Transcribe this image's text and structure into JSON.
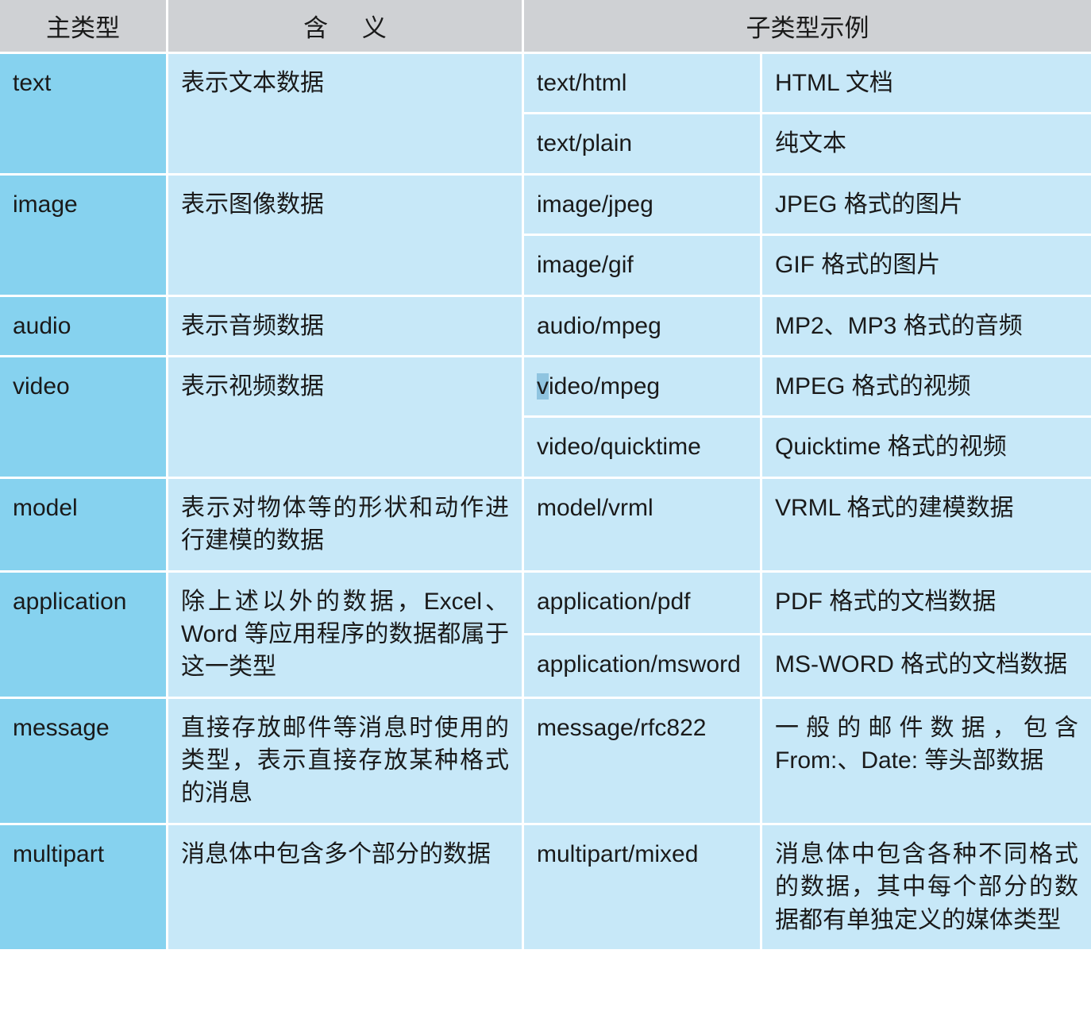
{
  "table": {
    "headers": {
      "main_type": "主类型",
      "meaning": "含 义",
      "subtype_examples": "子类型示例"
    },
    "colors": {
      "header_bg": "#cfd1d4",
      "main_col_bg": "#86d2ef",
      "cell_bg": "#c7e8f8",
      "gridline": "#ffffff",
      "text": "#1a1a1a",
      "selection_highlight": "#8fc4e0"
    },
    "rows": [
      {
        "main_type": "text",
        "meaning": "表示文本数据",
        "subtypes": [
          {
            "name": "text/html",
            "description": "HTML 文档"
          },
          {
            "name": "text/plain",
            "description": "纯文本"
          }
        ]
      },
      {
        "main_type": "image",
        "meaning": "表示图像数据",
        "subtypes": [
          {
            "name": "image/jpeg",
            "description": "JPEG 格式的图片"
          },
          {
            "name": "image/gif",
            "description": "GIF 格式的图片"
          }
        ]
      },
      {
        "main_type": "audio",
        "meaning": "表示音频数据",
        "subtypes": [
          {
            "name": "audio/mpeg",
            "description": "MP2、MP3 格式的音频"
          }
        ]
      },
      {
        "main_type": "video",
        "meaning": "表示视频数据",
        "subtypes": [
          {
            "name": "video/mpeg",
            "description": "MPEG 格式的视频",
            "selected_prefix": "v",
            "selected_rest": "ideo/mpeg"
          },
          {
            "name": "video/quicktime",
            "description": "Quicktime 格式的视频"
          }
        ]
      },
      {
        "main_type": "model",
        "meaning": "表示对物体等的形状和动作进行建模的数据",
        "subtypes": [
          {
            "name": "model/vrml",
            "description": "VRML 格式的建模数据"
          }
        ]
      },
      {
        "main_type": "application",
        "meaning": "除上述以外的数据，Excel、Word 等应用程序的数据都属于这一类型",
        "subtypes": [
          {
            "name": "application/pdf",
            "description": "PDF 格式的文档数据"
          },
          {
            "name": "application/msword",
            "description": "MS-WORD 格式的文档数据"
          }
        ]
      },
      {
        "main_type": "message",
        "meaning": "直接存放邮件等消息时使用的类型，表示直接存放某种格式的消息",
        "subtypes": [
          {
            "name": "message/rfc822",
            "description": "一般的邮件数据，包含 From:、Date: 等头部数据"
          }
        ]
      },
      {
        "main_type": "multipart",
        "meaning": "消息体中包含多个部分的数据",
        "subtypes": [
          {
            "name": "multipart/mixed",
            "description": "消息体中包含各种不同格式的数据，其中每个部分的数据都有单独定义的媒体类型"
          }
        ]
      }
    ]
  }
}
